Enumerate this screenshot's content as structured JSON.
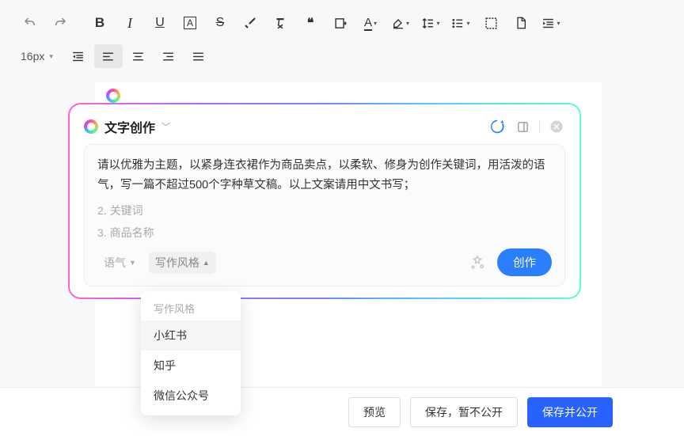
{
  "toolbar": {
    "font_size": "16px"
  },
  "ai": {
    "title": "文字创作",
    "prompt": "请以优雅为主题，以紧身连衣裙作为商品卖点，以柔软、修身为创作关键词，用活泼的语气，写一篇不超过500个字种草文稿。以上文案请用中文书写；",
    "placeholder2": "2. 关键词",
    "placeholder3": "3. 商品名称",
    "tone_btn": "语气",
    "style_btn": "写作风格",
    "create": "创作"
  },
  "style_dropdown": {
    "header": "写作风格",
    "options": [
      "小红书",
      "知乎",
      "微信公众号"
    ]
  },
  "bottom": {
    "preview": "预览",
    "save_draft": "保存，暂不公开",
    "publish": "保存并公开"
  }
}
